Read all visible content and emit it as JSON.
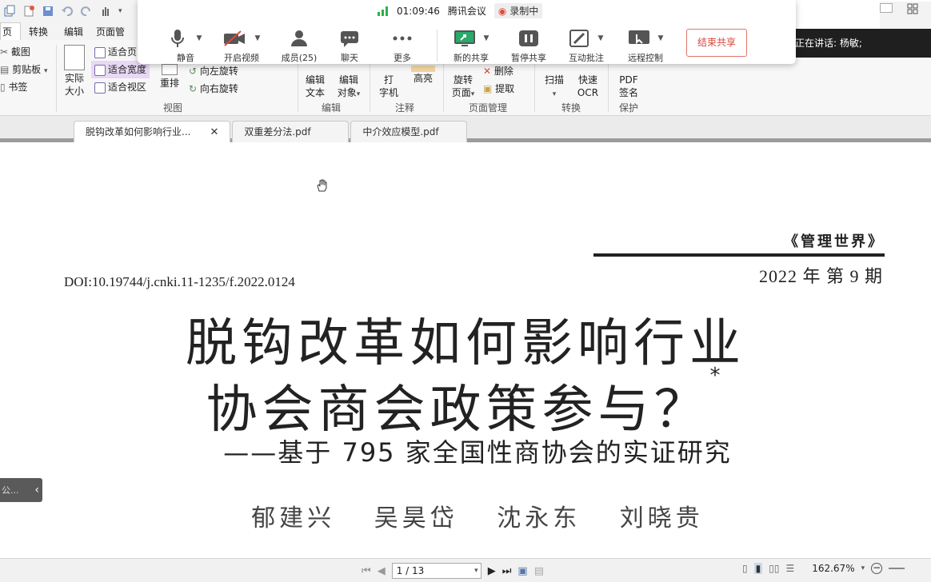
{
  "ribbon": {
    "menu_tabs": [
      "页",
      "转换",
      "编辑",
      "页面管"
    ],
    "clip": {
      "screenshot": "截图",
      "clipboard": "剪贴板",
      "bookmark": "书签"
    },
    "view": {
      "actual_size_1": "实际",
      "actual_size_2": "大小",
      "fit_page": "适合页",
      "fit_width": "适合宽度",
      "fit_view": "适合视区",
      "reflow": "重排",
      "rotate_left": "向左旋转",
      "rotate_right": "向右旋转",
      "group": "视图"
    },
    "edit": {
      "edit_text_1": "编辑",
      "edit_text_2": "文本",
      "edit_obj_1": "编辑",
      "edit_obj_2": "对象",
      "group": "编辑"
    },
    "annotate": {
      "typewriter_1": "打",
      "typewriter_2": "字机",
      "highlight": "高亮",
      "group": "注释"
    },
    "pages": {
      "rotate_1": "旋转",
      "rotate_2": "页面",
      "delete": "删除",
      "extract": "提取",
      "group": "页面管理"
    },
    "convert": {
      "scan": "扫描",
      "ocr_1": "快速",
      "ocr_2": "OCR",
      "group": "转换"
    },
    "protect": {
      "pdf_1": "PDF",
      "pdf_2": "签名",
      "group": "保护"
    }
  },
  "meeting": {
    "time": "01:09:46",
    "app": "腾讯会议",
    "recording": "录制中",
    "buttons": [
      "静音",
      "开启视频",
      "成员(25)",
      "聊天",
      "更多",
      "新的共享",
      "暂停共享",
      "互动批注",
      "远程控制"
    ],
    "end_share": "结束共享",
    "speaking": "正在讲话: 杨敏;"
  },
  "doc_tabs": [
    "脱钩改革如何影响行业...",
    "双重差分法.pdf",
    "中介效应模型.pdf"
  ],
  "doc": {
    "journal": "《管理世界》",
    "issue": "2022 年 第 9 期",
    "doi": "DOI:10.19744/j.cnki.11-1235/f.2022.0124",
    "title_line1": "脱钩改革如何影响行业",
    "title_line2": "协会商会政策参与？",
    "title_mark": "*",
    "subtitle": "——基于 795 家全国性商协会的实证研究",
    "authors": "郁建兴 吴昊岱 沈永东 刘晓贵",
    "side_label": "公..."
  },
  "status": {
    "page": "1 / 13",
    "zoom": "162.67%"
  }
}
